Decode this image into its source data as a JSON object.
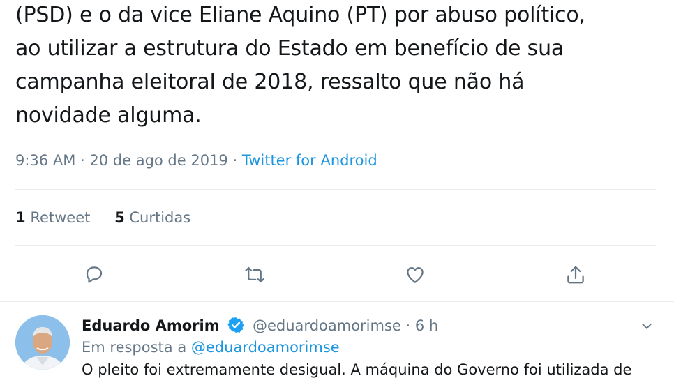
{
  "tweet": {
    "text": "(PSD) e o da vice Eliane Aquino (PT) por abuso político,\nao utilizar a estrutura do Estado em benefício de sua\ncampanha eleitoral de 2018, ressalto que não há\nnovidade alguma.",
    "time": "9:36 AM",
    "date": "20 de ago de 2019",
    "separator": " · ",
    "source": "Twitter for Android",
    "retweets_count": "1",
    "retweets_label": "Retweet",
    "likes_count": "5",
    "likes_label": "Curtidas"
  },
  "actions": {
    "reply_icon": "reply-icon",
    "retweet_icon": "retweet-icon",
    "like_icon": "heart-icon",
    "share_icon": "share-icon"
  },
  "reply": {
    "name": "Eduardo Amorim",
    "handle": "@eduardoamorimse",
    "separator": " · ",
    "age": "6 h",
    "reply_prefix": "Em resposta a ",
    "reply_to": "@eduardoamorimse",
    "text": "O pleito foi extremamente desigual. A máquina do Governo foi utilizada de"
  },
  "colors": {
    "text": "#14171a",
    "secondary": "#657786",
    "link": "#1b95e0",
    "divider": "#e6ecf0"
  }
}
